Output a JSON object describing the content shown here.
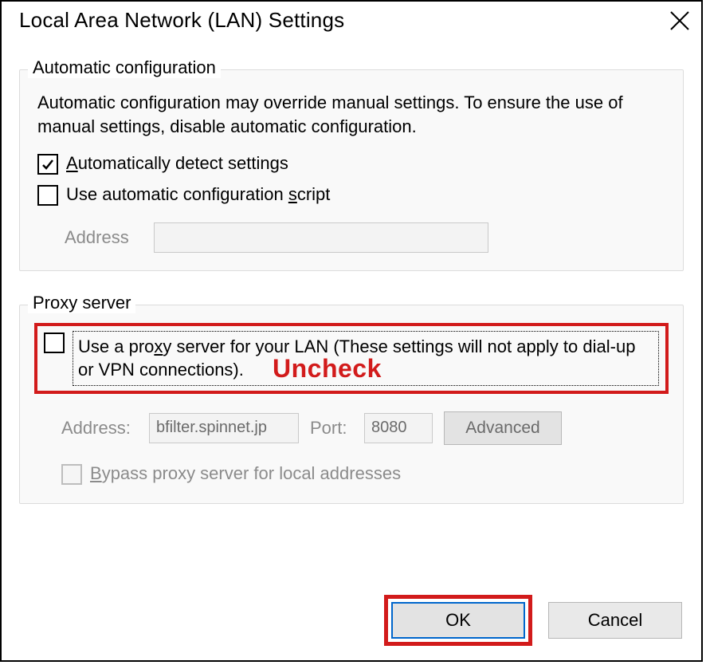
{
  "window": {
    "title": "Local Area Network (LAN) Settings"
  },
  "auto": {
    "legend": "Automatic configuration",
    "desc": "Automatic configuration may override manual settings.  To ensure the use of manual settings, disable automatic configuration.",
    "detect_prefix_u": "A",
    "detect_rest": "utomatically detect settings",
    "detect_checked": true,
    "script_prefix": "Use automatic configuration ",
    "script_u": "s",
    "script_rest": "cript",
    "script_checked": false,
    "address_label": "Address",
    "address_value": ""
  },
  "proxy": {
    "legend": "Proxy server",
    "annotation": "Uncheck",
    "use_proxy_pre": "Use a pro",
    "use_proxy_u": "x",
    "use_proxy_post": "y server for your LAN (These settings will not apply to dial-up or VPN connections).",
    "use_proxy_checked": false,
    "address_label": "Address:",
    "address_value": "bfilter.spinnet.jp",
    "port_label": "Port:",
    "port_value": "8080",
    "advanced_label": "Advanced",
    "bypass_u": "B",
    "bypass_rest": "ypass proxy server for local addresses",
    "bypass_checked": false
  },
  "buttons": {
    "ok": "OK",
    "cancel": "Cancel"
  }
}
